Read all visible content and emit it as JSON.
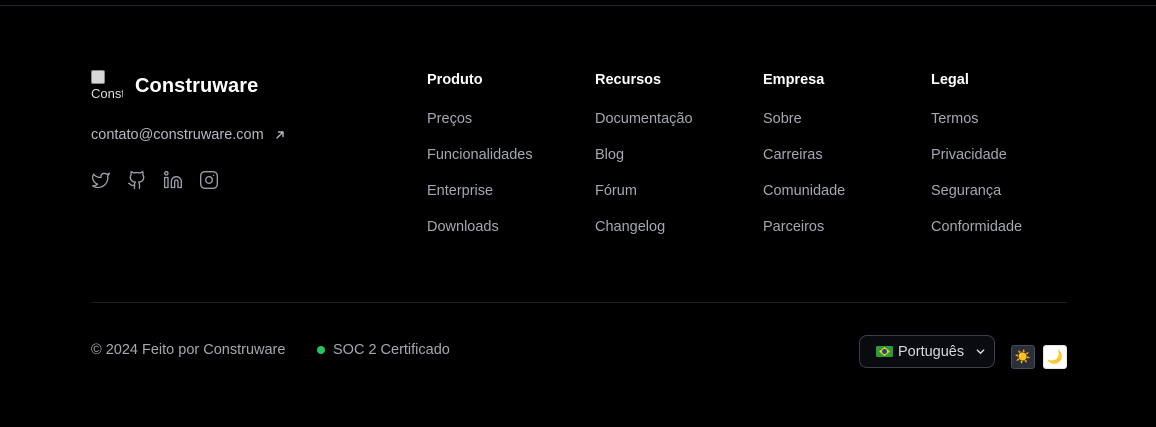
{
  "brand": {
    "logo_alt": "Construware",
    "name": "Construware"
  },
  "contact": {
    "email": "contato@construware.com",
    "link_icon": "arrow-up-right-icon"
  },
  "socials": [
    "twitter-icon",
    "github-icon",
    "linkedin-icon",
    "instagram-icon"
  ],
  "columns": [
    {
      "title": "Produto",
      "links": [
        "Preços",
        "Funcionalidades",
        "Enterprise",
        "Downloads"
      ]
    },
    {
      "title": "Recursos",
      "links": [
        "Documentação",
        "Blog",
        "Fórum",
        "Changelog"
      ]
    },
    {
      "title": "Empresa",
      "links": [
        "Sobre",
        "Carreiras",
        "Comunidade",
        "Parceiros"
      ]
    },
    {
      "title": "Legal",
      "links": [
        "Termos",
        "Privacidade",
        "Segurança",
        "Conformidade"
      ]
    }
  ],
  "bottom": {
    "copyright": "© 2024 Feito por Construware",
    "badge": "SOC 2 Certificado",
    "badge_color": "#22c55e",
    "language": "Português",
    "theme_light_icon": "☀️",
    "theme_dark_icon": "🌙"
  },
  "colors": {
    "background": "#000000",
    "text_muted": "#a3a8b2",
    "heading": "#ffffff"
  }
}
